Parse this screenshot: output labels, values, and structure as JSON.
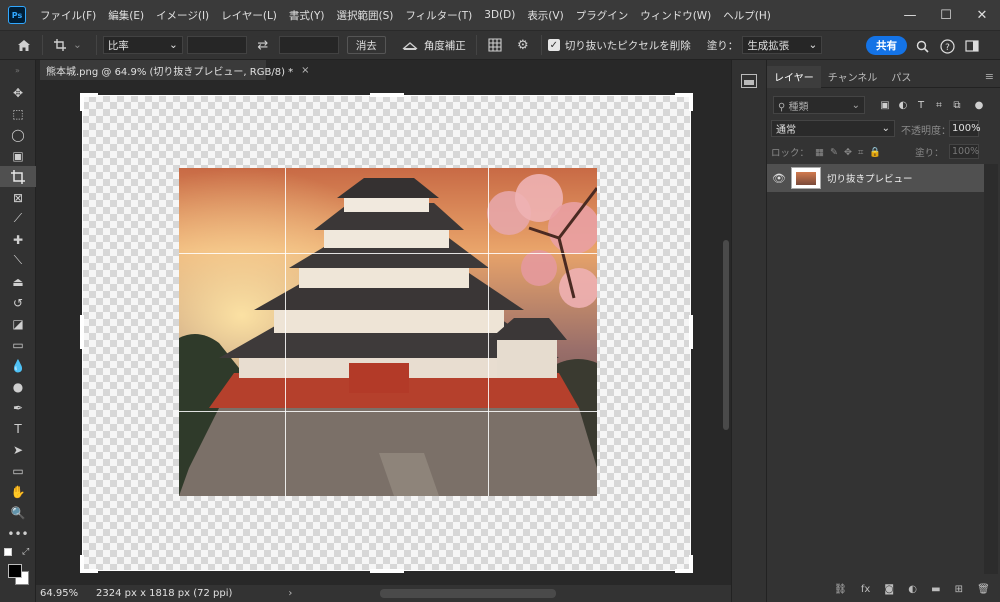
{
  "app": {
    "logo_text": "Ps",
    "accent_color": "#31a8ff",
    "share_color": "#1473e6"
  },
  "menu": {
    "items": [
      "ファイル(F)",
      "編集(E)",
      "イメージ(I)",
      "レイヤー(L)",
      "書式(Y)",
      "選択範囲(S)",
      "フィルター(T)",
      "3D(D)",
      "表示(V)",
      "プラグイン",
      "ウィンドウ(W)",
      "ヘルプ(H)"
    ]
  },
  "window": {
    "minimize": "—",
    "maximize": "☐",
    "close": "✕"
  },
  "options": {
    "ratio_label": "比率",
    "clear_label": "消去",
    "straighten_label": "角度補正",
    "delete_cropped_label": "切り抜いたピクセルを削除",
    "delete_cropped_checked": true,
    "fill_label": "塗り：",
    "fill_value": "生成拡張",
    "share_label": "共有"
  },
  "document": {
    "tab_title": "熊本城.png @ 64.9% (切り抜きプレビュー, RGB/8) *",
    "close_glyph": "×"
  },
  "status": {
    "zoom": "64.95%",
    "info": "2324 px x 1818 px (72 ppi)",
    "arrow": "›"
  },
  "layers_panel": {
    "tabs": [
      "レイヤー",
      "チャンネル",
      "パス"
    ],
    "active_tab": 0,
    "filter_placeholder": "種類",
    "blend_mode": "通常",
    "opacity_label": "不透明度：",
    "opacity_value": "100%",
    "lock_label": "ロック：",
    "fill_label": "塗り：",
    "fill_value": "100%",
    "layers": [
      {
        "name": "切り抜きプレビュー",
        "visible": true,
        "selected": true
      }
    ]
  },
  "icons": {
    "tools": [
      "move-icon",
      "marquee-icon",
      "lasso-icon",
      "object-select-icon",
      "crop-icon",
      "frame-icon",
      "eyedropper-icon",
      "healing-icon",
      "brush-icon",
      "stamp-icon",
      "history-brush-icon",
      "eraser-icon",
      "gradient-icon",
      "blur-icon",
      "dodge-icon",
      "pen-icon",
      "type-icon",
      "path-select-icon",
      "rectangle-icon",
      "hand-icon",
      "zoom-icon",
      "more-tools-icon"
    ]
  }
}
